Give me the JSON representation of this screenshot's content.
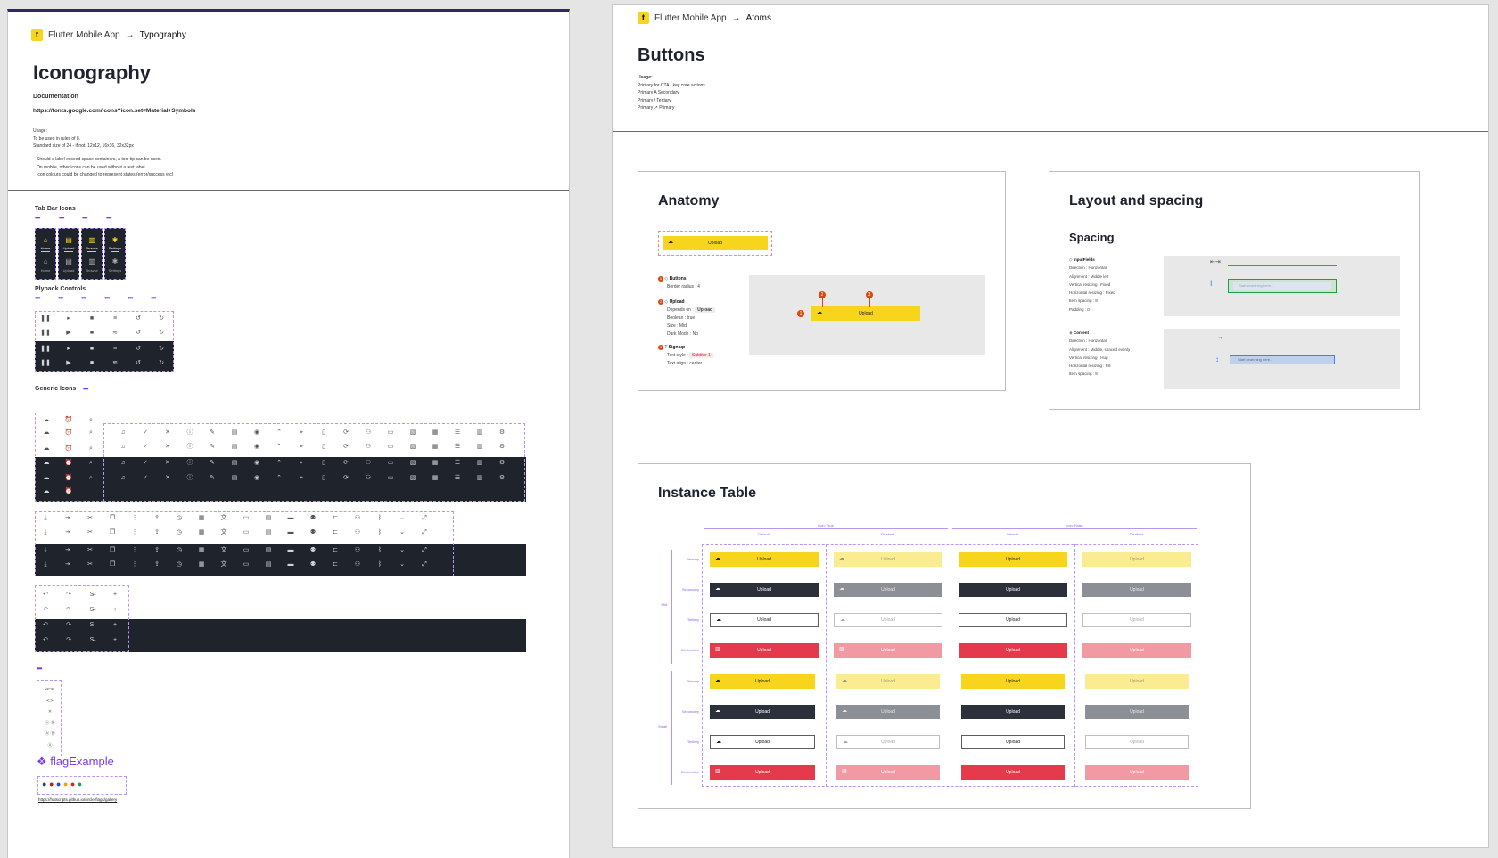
{
  "left": {
    "breadcrumb": {
      "project": "Flutter Mobile App",
      "arrow": "→",
      "current": "Typography"
    },
    "title": "Iconography",
    "doc_label": "Documentation",
    "doc_url": "https://fonts.google.com/icons?icon.set=Material+Symbols",
    "usage": [
      "Usage:",
      "To be used in rules of 8.",
      "Standard size of 24 - if not, 12x12, 16x16, 32x32px"
    ],
    "bullets": [
      "Should a label exceed space containers, a tool tip can be used.",
      "On mobile, other icons can be used without a text label.",
      "Icon colours could be changed to represent states (error/success etc)"
    ],
    "sections": {
      "tab_bar": "Tab Bar Icons",
      "playback": "Plyback Controls",
      "generic": "Generic Icons"
    },
    "dots": "•••",
    "tabs": [
      {
        "label": "Home",
        "icon": "home-icon",
        "glyph": "⌂"
      },
      {
        "label": "Upload",
        "icon": "upload-icon",
        "glyph": "▤"
      },
      {
        "label": "Browse",
        "icon": "browse-icon",
        "glyph": "▥"
      },
      {
        "label": "Settings",
        "icon": "settings-icon",
        "glyph": "✱"
      }
    ],
    "flag_title": "flagExample",
    "flag_url": "https://hatscripts.github.io/circle-flags/gallery"
  },
  "right": {
    "breadcrumb": {
      "project": "Flutter Mobile App",
      "arrow": "→",
      "current": "Atoms"
    },
    "title": "Buttons",
    "usage": [
      "Usage:",
      "Primary for CTA - key core actions",
      "Primary A Secondary",
      "Primary / Tertiary",
      "Primary ↗ Primary"
    ],
    "anatomy": {
      "title": "Anatomy",
      "button_label": "Upload",
      "parts": [
        {
          "num": "1",
          "name": "Buttons",
          "lines": [
            "Border radius : 4"
          ]
        },
        {
          "num": "2",
          "name": "Upload",
          "lines": [
            "Depends on :",
            "Boolean : true",
            "Size : Mid",
            "Dark Mode : No"
          ],
          "chip": "Upload"
        },
        {
          "num": "3",
          "name": "Sign up",
          "lines": [
            "Text style :",
            "Text align : center"
          ],
          "chip": "Subtitle 1"
        }
      ],
      "markers": [
        "1",
        "2",
        "3"
      ]
    },
    "layout": {
      "title": "Layout and spacing",
      "subtitle": "Spacing",
      "input_fields": {
        "name": "InputFields",
        "lines": [
          "Direction : Horizontal",
          "Alignment : Middle left",
          "Vertical resizing : Fixed",
          "Horizontal resizing : Fixed",
          "Item spacing : 8",
          "Padding : 0"
        ]
      },
      "content": {
        "name": "Content",
        "lines": [
          "Direction : Horizontal",
          "Alignment : Middle, spaced evenly",
          "Vertical resizing : Hug",
          "Horizontal resizing : Fill",
          "Item spacing : 8"
        ]
      },
      "placeholder": "Start searching here..."
    },
    "instance": {
      "title": "Instance Table",
      "groups": [
        "Icon: True",
        "Icon: False"
      ],
      "columns": [
        "Default",
        "Disabled",
        "Default",
        "Disabled"
      ],
      "sizes": [
        "Mid",
        "Small"
      ],
      "rows": [
        "Primary",
        "Secondary",
        "Tertiary",
        "Destructive"
      ],
      "button_label": "Upload"
    }
  }
}
